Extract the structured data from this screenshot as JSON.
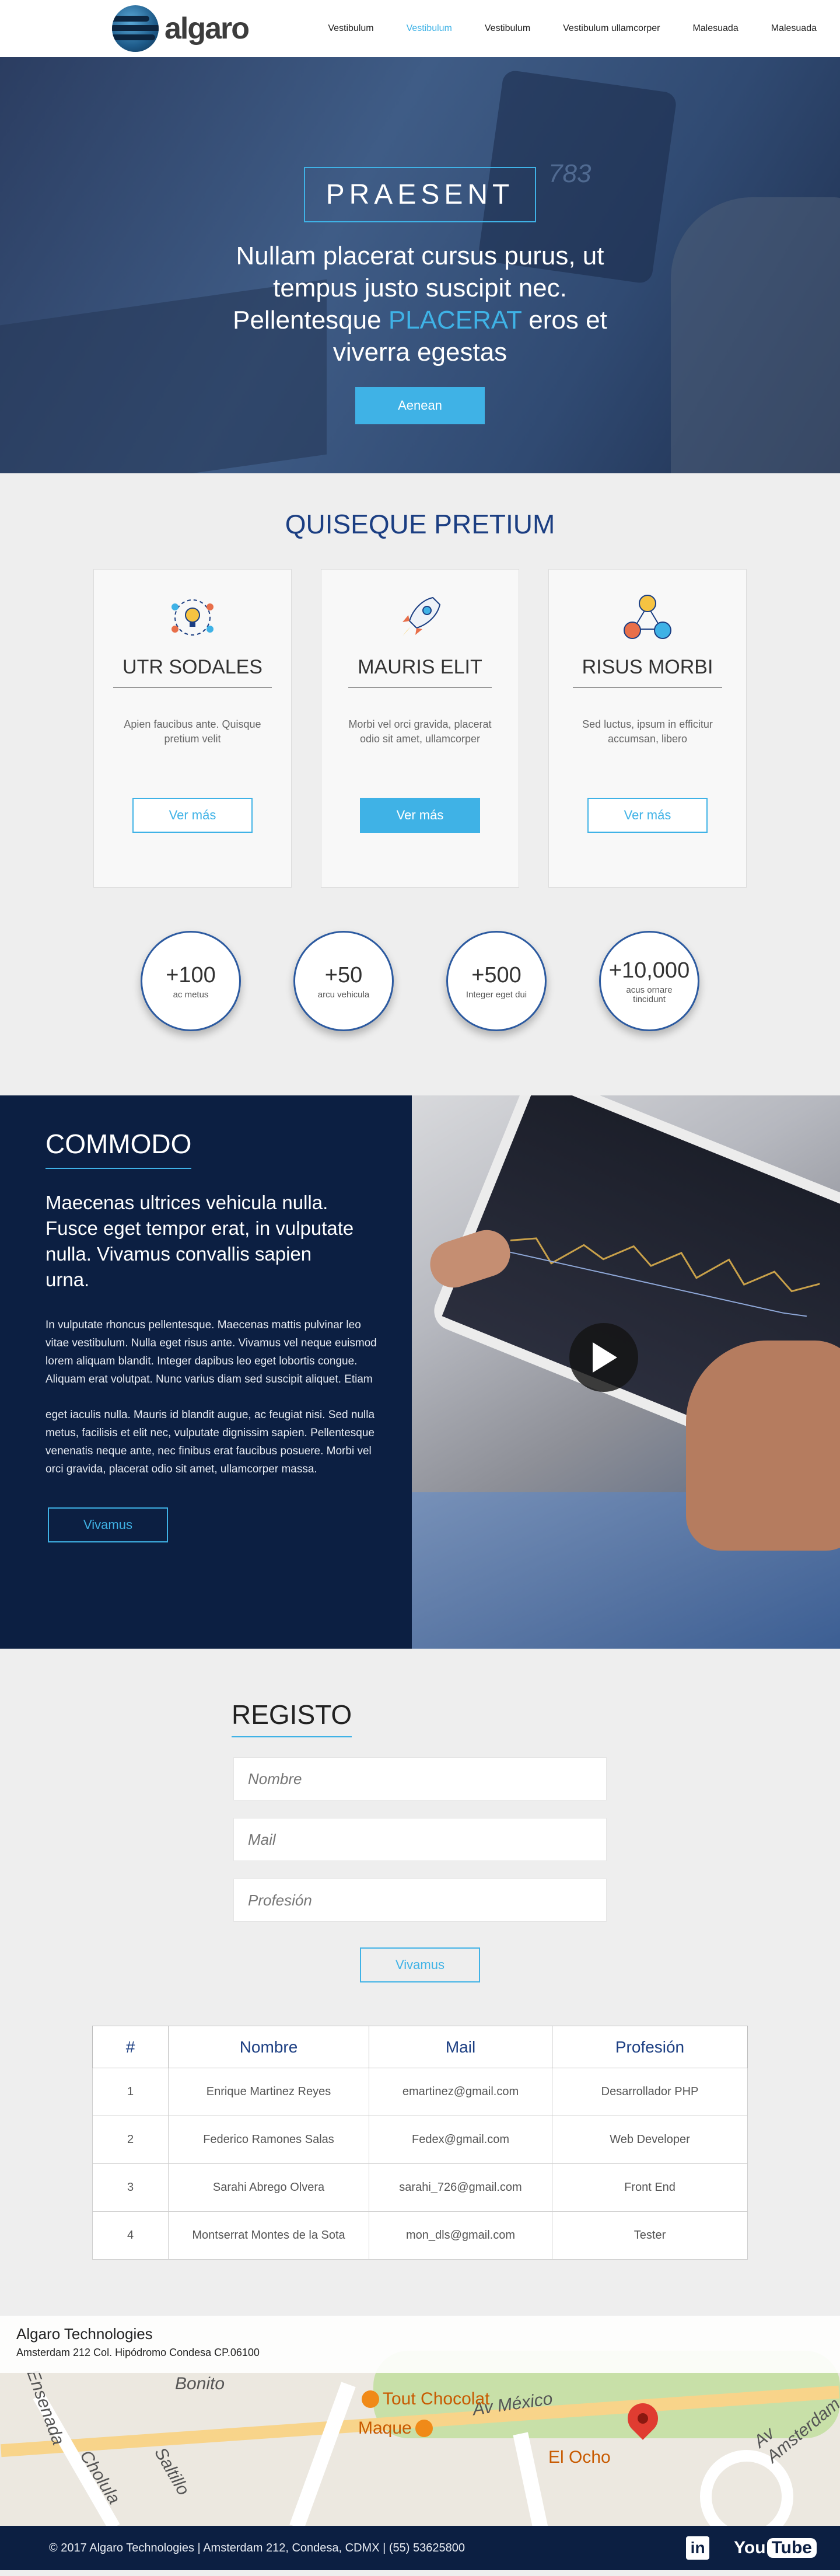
{
  "brand": {
    "name": "algaro"
  },
  "nav": {
    "items": [
      {
        "label": "Vestibulum",
        "active": false
      },
      {
        "label": "Vestibulum",
        "active": true
      },
      {
        "label": "Vestibulum",
        "active": false
      },
      {
        "label": "Vestibulum ullamcorper",
        "active": false
      },
      {
        "label": "Malesuada",
        "active": false
      },
      {
        "label": "Malesuada",
        "active": false
      }
    ]
  },
  "hero": {
    "badge": "PRAESENT",
    "headline_pre": "Nullam placerat cursus purus, ut tempus justo suscipit nec. Pellentesque ",
    "headline_highlight": "PLACERAT",
    "headline_post": " eros et viverra egestas",
    "button": "Aenean",
    "phone_text": "783"
  },
  "services": {
    "title": "QUISEQUE PRETIUM",
    "cards": [
      {
        "icon": "ideas-icon",
        "title": "UTR SODALES",
        "text": "Apien faucibus ante. Quisque pretium velit",
        "button": "Ver más",
        "filled": false
      },
      {
        "icon": "rocket-icon",
        "title": "MAURIS ELIT",
        "text": "Morbi vel orci gravida, placerat odio sit amet, ullamcorper",
        "button": "Ver más",
        "filled": true
      },
      {
        "icon": "team-icon",
        "title": "RISUS MORBI",
        "text": "Sed luctus, ipsum in efficitur accumsan, libero",
        "button": "Ver más",
        "filled": false
      }
    ],
    "stats": [
      {
        "value": "+100",
        "label": "ac metus"
      },
      {
        "value": "+50",
        "label": "arcu vehicula"
      },
      {
        "value": "+500",
        "label": "Integer eget dui"
      },
      {
        "value": "+10,000",
        "label": "acus ornare tincidunt"
      }
    ]
  },
  "commodo": {
    "title": "COMMODO",
    "lead": "Maecenas ultrices vehicula  nulla. Fusce eget tempor erat, in vulputate nulla. Vivamus convallis sapien urna.",
    "paragraph1": "In vulputate rhoncus pellentesque. Maecenas mattis pulvinar leo vitae vestibulum. Nulla eget risus ante. Vivamus vel neque euismod lorem aliquam blandit. Integer dapibus leo eget lobortis congue. Aliquam erat volutpat. Nunc varius diam sed suscipit aliquet. Etiam",
    "paragraph2": "eget iaculis nulla. Mauris id blandit augue, ac feugiat nisi. Sed nulla metus, facilisis et elit nec, vulputate dignissim sapien. Pellentesque venenatis neque ante, nec finibus erat faucibus posuere. Morbi vel orci gravida, placerat odio sit amet, ullamcorper massa.",
    "button": "Vivamus"
  },
  "registro": {
    "title": "REGISTO",
    "fields": {
      "name_placeholder": "Nombre",
      "mail_placeholder": "Mail",
      "profession_placeholder": "Profesión"
    },
    "button": "Vivamus",
    "table": {
      "headers": [
        "#",
        "Nombre",
        "Mail",
        "Profesión"
      ],
      "rows": [
        [
          "1",
          "Enrique Martinez Reyes",
          "emartinez@gmail.com",
          "Desarrollador PHP"
        ],
        [
          "2",
          "Federico Ramones Salas",
          "Fedex@gmail.com",
          "Web Developer"
        ],
        [
          "3",
          "Sarahi Abrego Olvera",
          "sarahi_726@gmail.com",
          "Front End"
        ],
        [
          "4",
          "Montserrat Montes de la Sota",
          "mon_dls@gmail.com",
          "Tester"
        ]
      ]
    }
  },
  "map": {
    "company": "Algaro Technologies",
    "address": "Amsterdam 212 Col. Hipódromo Condesa CP.06100",
    "places": {
      "tout": "Tout Chocolat",
      "maque": "Maque",
      "ocho": "El Ocho"
    },
    "streets": {
      "mexico": "Av México",
      "suarez": "Ensenada",
      "saltillo": "Saltillo",
      "cholula": "Cholula",
      "amsterdam": "Av Amsterdam",
      "bonito": "Bonito"
    }
  },
  "footer": {
    "text": "© 2017 Algaro Technologies  | Amsterdam 212, Condesa, CDMX | (55) 53625800",
    "linkedin": "in",
    "youtube_you": "You",
    "youtube_tube": "Tube"
  },
  "colors": {
    "accent": "#3fb2e6",
    "navy": "#0c1f42",
    "title_blue": "#1b3e82"
  }
}
